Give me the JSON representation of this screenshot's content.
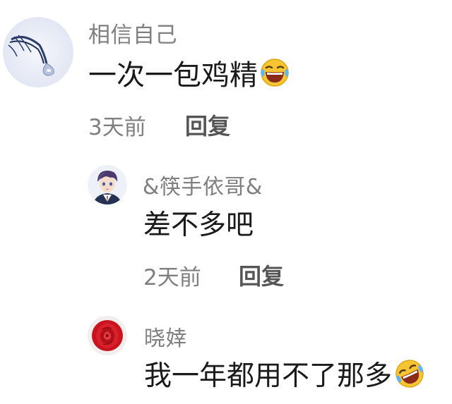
{
  "comments": [
    {
      "username": "相信自己",
      "text": "一次一包鸡精",
      "emoji": "laughing-tears-emoji",
      "time": "3天前",
      "reply_label": "回复",
      "avatar": "teardrop-eye-avatar"
    },
    {
      "username": "&筷手依哥&",
      "text": "差不多吧",
      "time": "2天前",
      "reply_label": "回复",
      "avatar": "anime-boy-avatar"
    },
    {
      "username": "晓婞",
      "text": "我一年都用不了那多",
      "emoji": "rolling-laughing-emoji",
      "avatar": "red-rose-avatar"
    }
  ],
  "colors": {
    "username": "#7f7f7f",
    "text": "#1a1a1a",
    "meta": "#7f7f7f",
    "reply": "#555555",
    "background": "#ffffff"
  }
}
